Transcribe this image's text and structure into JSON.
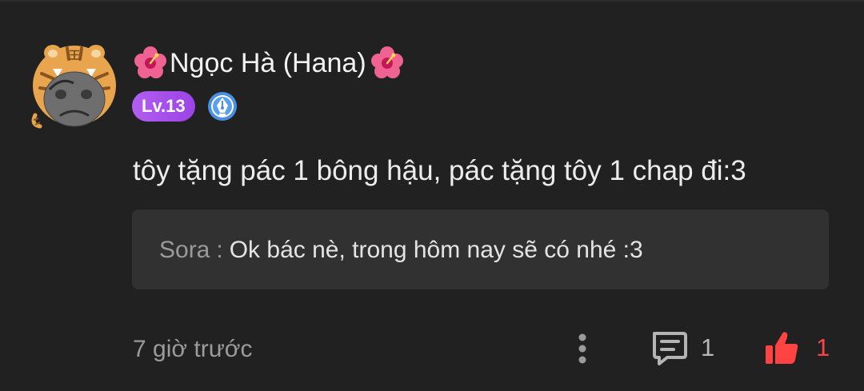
{
  "user": {
    "name": "Ngọc Hà (Hana)",
    "level": "Lv.13"
  },
  "comment": {
    "text": "tôy tặng pác 1 bông hậu, pác tặng tôy 1 chap đi:3",
    "timestamp": "7 giờ trước",
    "reply_count": "1",
    "like_count": "1"
  },
  "reply": {
    "author": "Sora",
    "separator": ":",
    "text": "Ok bác nè, trong hôm nay sẽ có nhé :3"
  },
  "icons": {
    "avatar": "tiger-hat-avatar-icon",
    "decoration": "hibiscus-flower-icon",
    "badge": "pen-nib-badge-icon",
    "more": "more-vertical-icon",
    "reply": "comment-bubble-icon",
    "like": "thumbs-up-icon"
  },
  "colors": {
    "background": "#212121",
    "reply_box": "#313131",
    "level_badge": "#a64eea",
    "badge_blue": "#4a90e2",
    "like_red": "#ff4242"
  }
}
